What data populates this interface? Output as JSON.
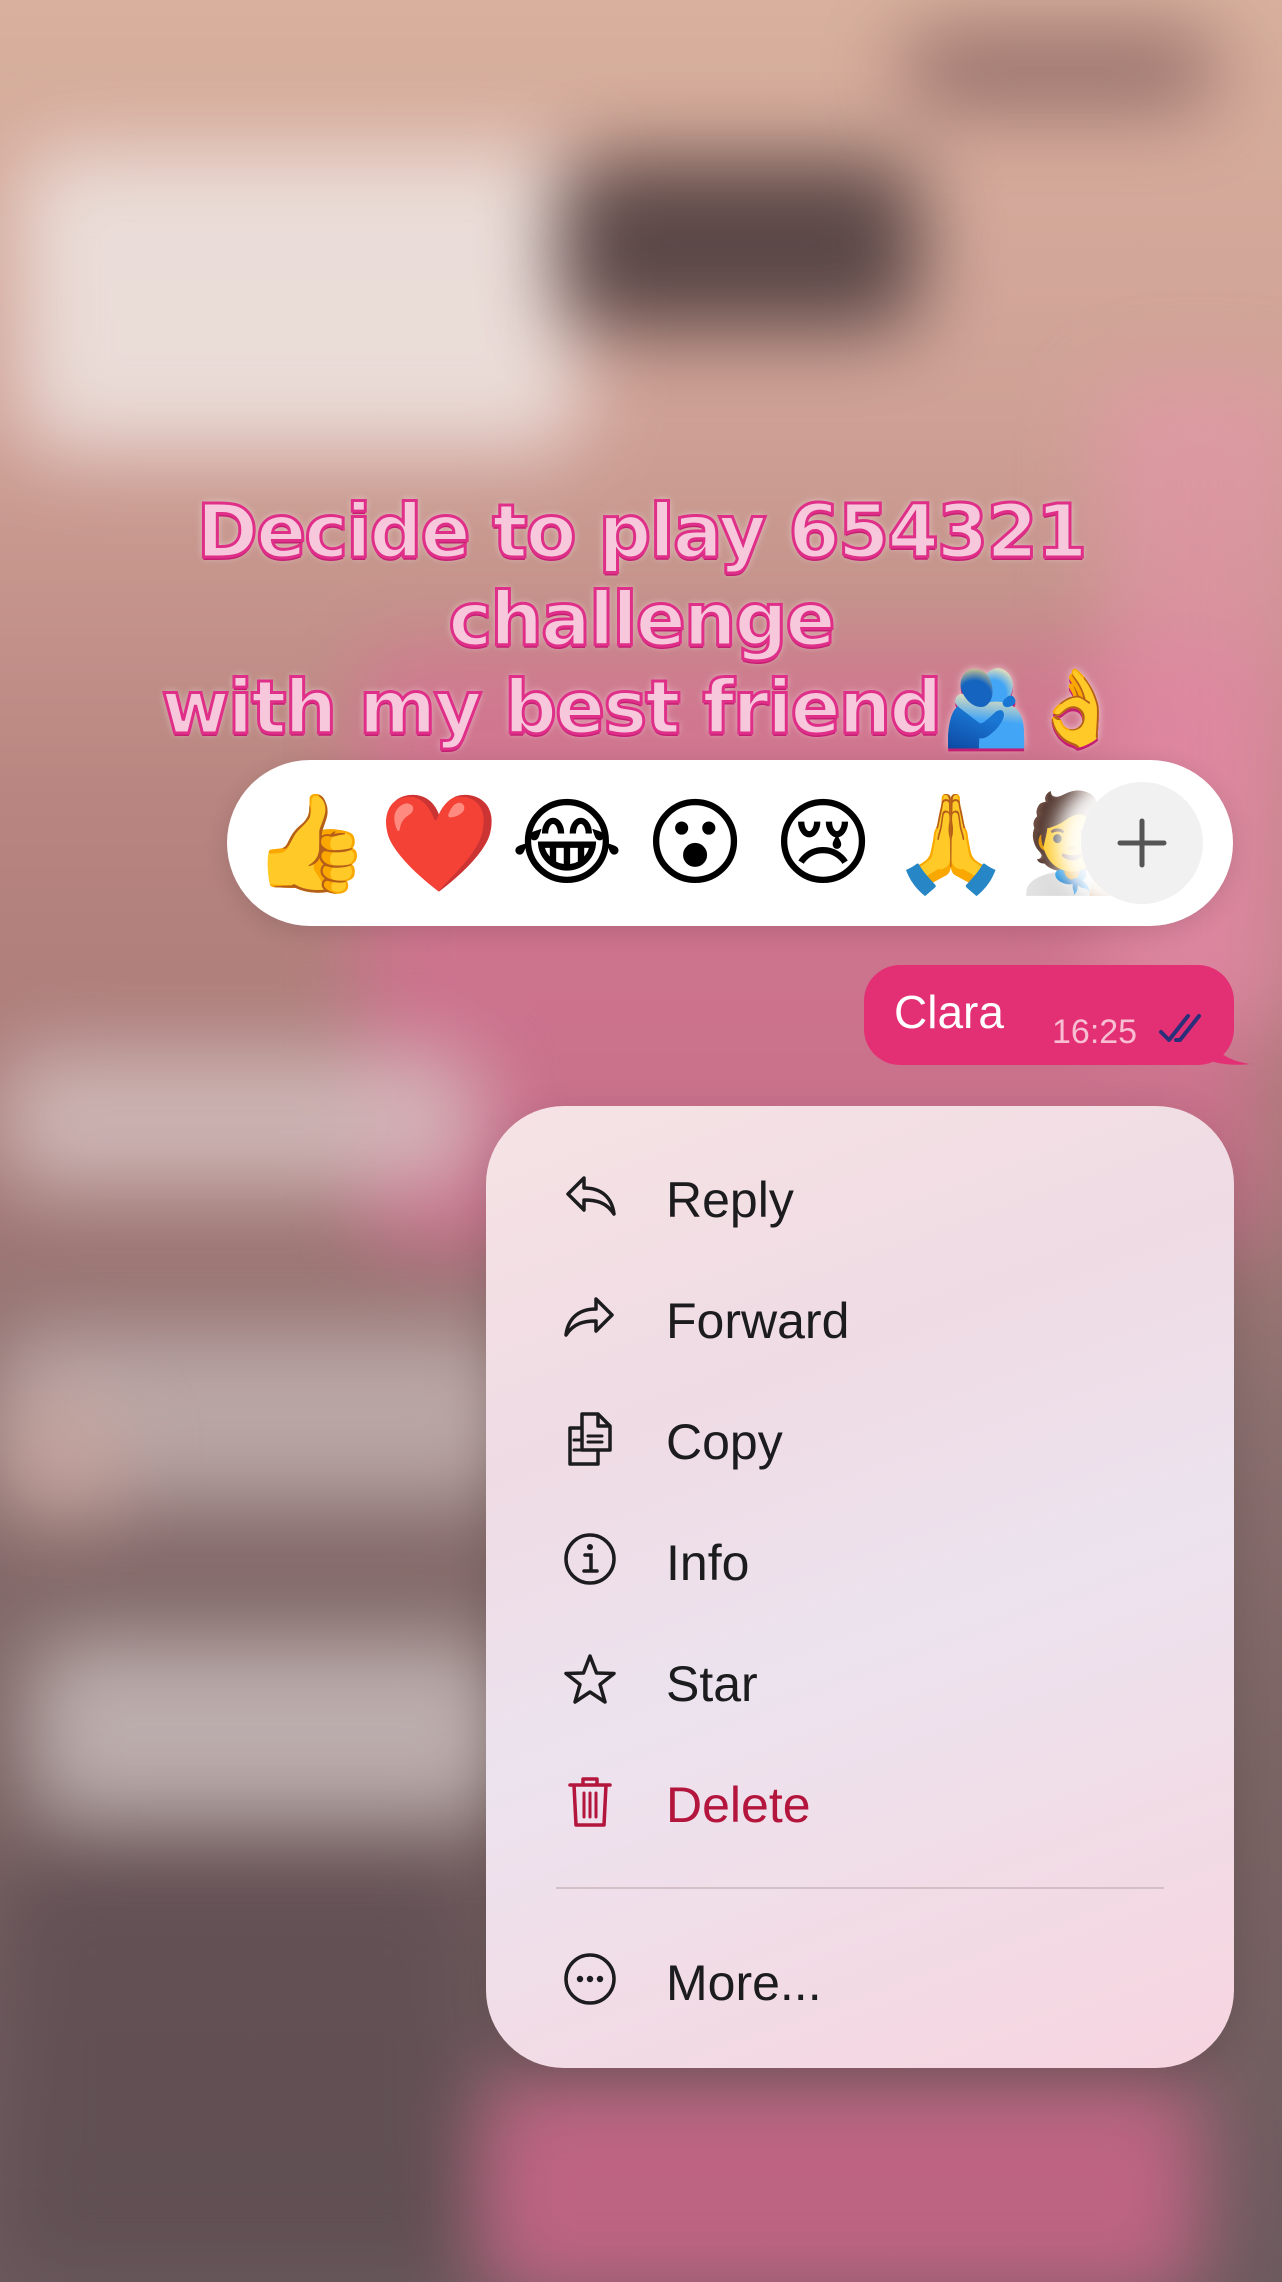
{
  "caption": {
    "line1": "Decide to play 654321 challenge",
    "line2": "with my best friend🫂👌"
  },
  "reactions": {
    "emojis": [
      "👍",
      "❤️",
      "😂",
      "😮",
      "😢",
      "🙏",
      "🧑‍🎨"
    ],
    "more_icon": "plus-icon"
  },
  "message": {
    "text": "Clara",
    "time": "16:25",
    "status_icon": "double-check-icon",
    "color": "#e32f74"
  },
  "menu": {
    "items": [
      {
        "label": "Reply",
        "icon": "reply-arrow-icon"
      },
      {
        "label": "Forward",
        "icon": "forward-arrow-icon"
      },
      {
        "label": "Copy",
        "icon": "copy-icon"
      },
      {
        "label": "Info",
        "icon": "info-icon"
      },
      {
        "label": "Star",
        "icon": "star-icon"
      },
      {
        "label": "Delete",
        "icon": "trash-icon",
        "color": "#b3153d"
      },
      {
        "label": "More...",
        "icon": "more-circle-icon"
      }
    ]
  }
}
